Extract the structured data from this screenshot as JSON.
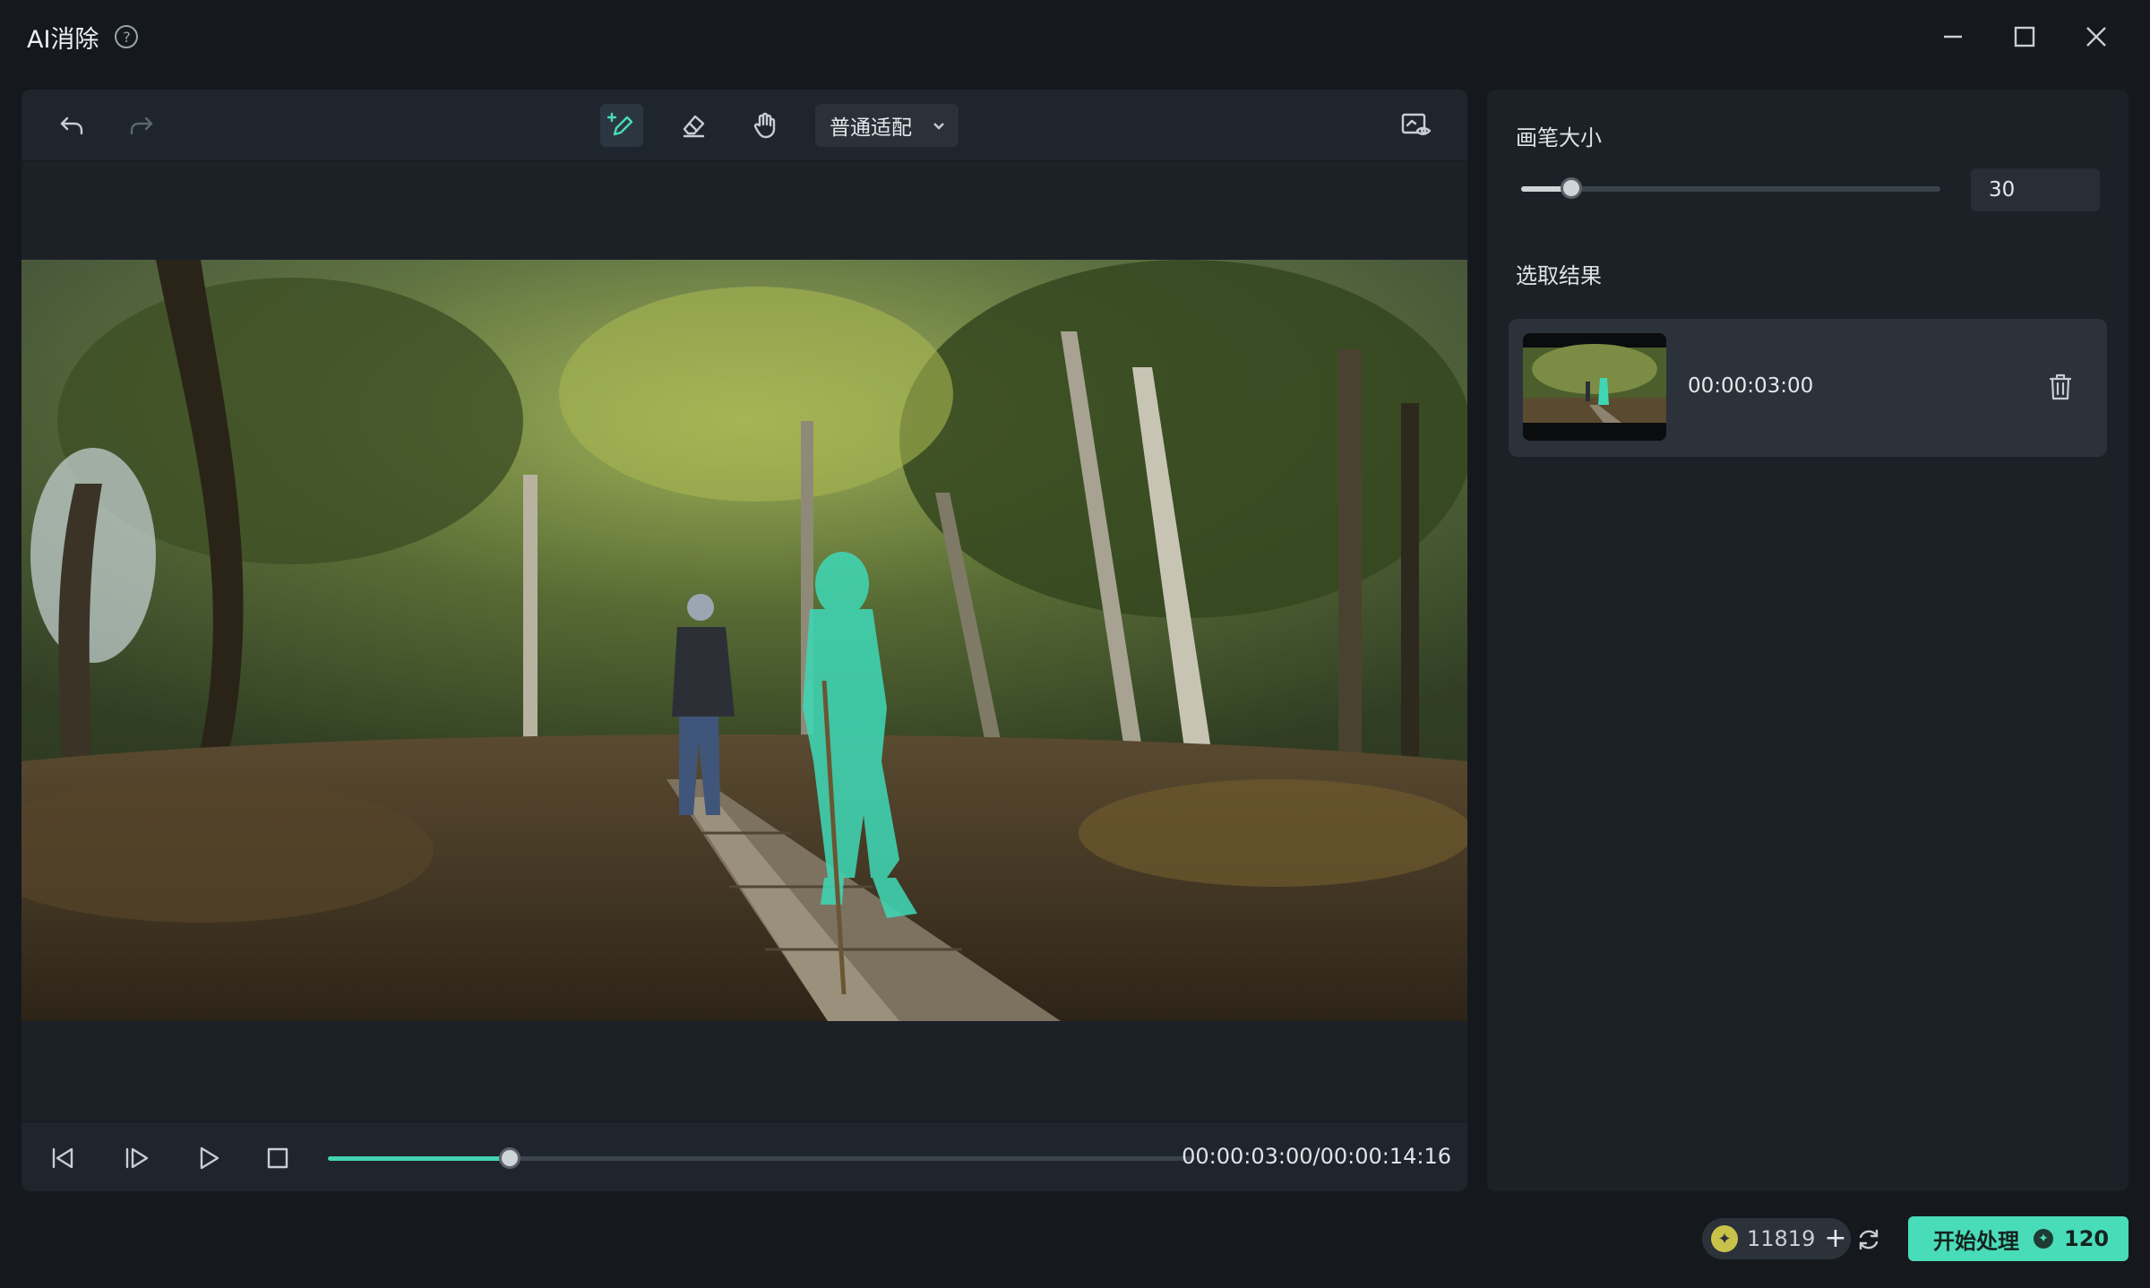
{
  "window": {
    "title": "AI消除",
    "help_icon": "?"
  },
  "toolbar": {
    "undo_icon": "undo-icon",
    "redo_icon": "redo-icon",
    "brush_icon": "brush-plus-icon",
    "eraser_icon": "eraser-icon",
    "hand_icon": "hand-icon",
    "mode_select": "普通适配",
    "preview_icon": "preview-eye-icon"
  },
  "player": {
    "timecode": "00:00:03:00/00:00:14:16",
    "progress": 0.21
  },
  "side": {
    "brush_size_label": "画笔大小",
    "brush_size_value": "30",
    "brush_size_fraction": 0.12,
    "results_label": "选取结果",
    "results": [
      {
        "time": "00:00:03:00"
      }
    ]
  },
  "footer": {
    "credits": "11819",
    "plus": "+",
    "start_label": "开始处理",
    "start_cost": "120"
  },
  "colors": {
    "accent": "#49dcb9",
    "mask": "#3fd6b4",
    "background": "#15191e",
    "panel": "#1c2128"
  }
}
